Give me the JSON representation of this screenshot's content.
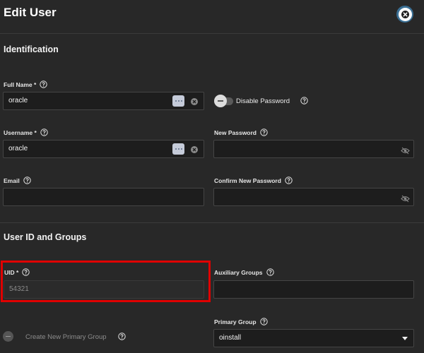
{
  "dialog": {
    "title": "Edit User"
  },
  "identification": {
    "title": "Identification",
    "full_name": {
      "label": "Full Name *",
      "value": "oracle"
    },
    "disable_password": {
      "label": "Disable Password",
      "checked": false
    },
    "username": {
      "label": "Username *",
      "value": "oracle"
    },
    "new_password": {
      "label": "New Password",
      "value": ""
    },
    "email": {
      "label": "Email",
      "value": ""
    },
    "confirm_password": {
      "label": "Confirm New Password",
      "value": ""
    }
  },
  "groups": {
    "title": "User ID and Groups",
    "uid": {
      "label": "UID *",
      "value": "54321"
    },
    "auxiliary_groups": {
      "label": "Auxiliary Groups",
      "value": ""
    },
    "primary_group": {
      "label": "Primary Group",
      "value": "oinstall"
    },
    "create_primary_group": {
      "label": "Create New Primary Group",
      "checked": false,
      "enabled": false
    }
  },
  "icons": {
    "close": "close-icon",
    "help": "help-icon",
    "more": "more-dots-icon",
    "clear": "clear-icon",
    "visibility": "eye-off-icon",
    "dropdown": "chevron-down-icon"
  },
  "colors": {
    "background": "#282828",
    "field_background": "#1d1d1d",
    "highlight_box": "#e00000",
    "close_ring": "#3a6f94"
  }
}
